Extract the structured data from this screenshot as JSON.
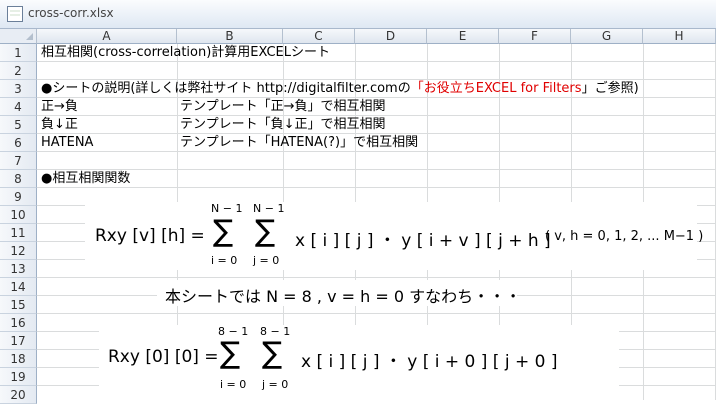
{
  "window": {
    "filename": "cross-corr.xlsx"
  },
  "columns": [
    "A",
    "B",
    "C",
    "D",
    "E",
    "F",
    "G",
    "H"
  ],
  "rows": [
    "1",
    "2",
    "3",
    "4",
    "5",
    "6",
    "7",
    "8",
    "9",
    "10",
    "11",
    "12",
    "13",
    "14",
    "15",
    "16",
    "17",
    "18",
    "19",
    "20"
  ],
  "cells": {
    "r1": "相互相関(cross-correlation)計算用EXCELシート",
    "r3_a": "●シートの説明(詳しくは弊社サイト http://digitalfilter.comの",
    "r3_red": "「お役立ちEXCEL for Filters",
    "r3_b": "」ご参照)",
    "r4_a": "正→負",
    "r4_b": "テンプレート「正→負」で相互相関",
    "r5_a": "負↓正",
    "r5_b": "テンプレート「負↓正」で相互相関",
    "r6_a": "HATENA",
    "r6_b": "テンプレート「HATENA(?)」で相互相関",
    "r8": "●相互相関関数"
  },
  "formula1": {
    "lhs": "Rxy [v] [h] =",
    "upper1": "N − 1",
    "upper2": "N − 1",
    "sigma": "∑",
    "lower1": "i = 0",
    "lower2": "j = 0",
    "body": "x [ i ] [ j ] ・ y [ i + v ] [ j + h ]",
    "note": "( v, h = 0, 1, 2, ... M−1 )"
  },
  "middle_text": "本シートでは N = 8 , v = h = 0 すなわち・・・",
  "formula2": {
    "lhs": "Rxy [0] [0] =",
    "upper1": "8 − 1",
    "upper2": "8 − 1",
    "sigma": "∑",
    "lower1": "i = 0",
    "lower2": "j = 0",
    "body": "x [ i ] [ j ] ・ y [ i + 0 ] [ j + 0 ]"
  }
}
